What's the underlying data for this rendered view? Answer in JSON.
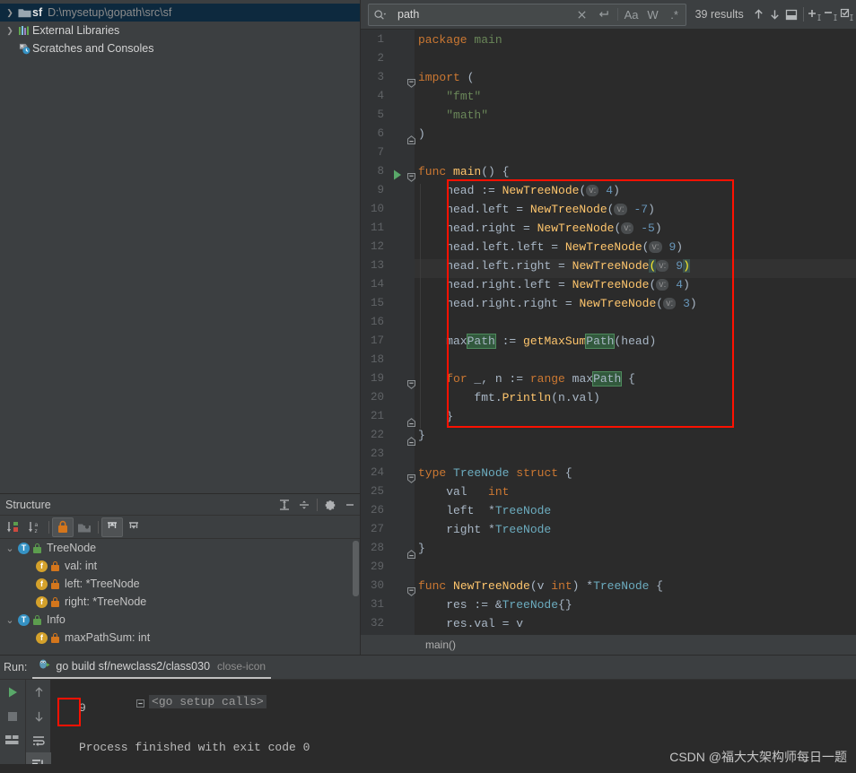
{
  "project": {
    "items": [
      {
        "arrow": "❯",
        "icon": "folder-icon",
        "name": "sf",
        "path": "D:\\mysetup\\gopath\\src\\sf",
        "selected": true
      },
      {
        "arrow": "❯",
        "icon": "libraries-icon",
        "name": "External Libraries",
        "path": "",
        "selected": false
      },
      {
        "arrow": "",
        "icon": "scratches-icon",
        "name": "Scratches and Consoles",
        "path": "",
        "selected": false
      }
    ]
  },
  "search": {
    "magnifier_icon": "search-icon",
    "dropdown_icon": "chevron-down-icon",
    "value": "path",
    "placeholder": "Search",
    "clear_icon": "close-icon",
    "newline_icon": "newline-icon",
    "match_case_label": "Aa",
    "words_label": "W",
    "regex_label": ".*",
    "results": "39 results",
    "prev_icon": "arrow-up-icon",
    "next_icon": "arrow-down-icon",
    "open_in_window_icon": "open-in-find-window-icon",
    "add_selection_icon": "add-selection-icon",
    "remove_selection_icon": "remove-selection-icon",
    "select_all_icon": "select-all-occurrences-icon"
  },
  "editor": {
    "caret_line": 13,
    "breadcrumb": "main()",
    "highlight_color": "#32593d",
    "redbox_color": "#ff1100",
    "lines": [
      {
        "n": 1,
        "fold": "",
        "html": "<span class=\"kw\">package</span> <span class=\"pkg\">main</span>"
      },
      {
        "n": 2,
        "fold": "",
        "html": ""
      },
      {
        "n": 3,
        "fold": "open",
        "html": "<span class=\"kw\">import</span> <span class=\"typ\">(</span>"
      },
      {
        "n": 4,
        "fold": "",
        "html": "    <span class=\"str\">\"fmt\"</span>"
      },
      {
        "n": 5,
        "fold": "",
        "html": "    <span class=\"str\">\"math\"</span>"
      },
      {
        "n": 6,
        "fold": "close",
        "html": "<span class=\"typ\">)</span>"
      },
      {
        "n": 7,
        "fold": "",
        "html": ""
      },
      {
        "n": 8,
        "fold": "open",
        "html": "<span class=\"kw\">func</span> <span class=\"fn\">main</span>() {",
        "runmark": true
      },
      {
        "n": 9,
        "fold": "",
        "html": "    head := <span class=\"fn\">NewTreeNode</span>(<span class=\"hint\">v:</span> <span class=\"num\">4</span>)"
      },
      {
        "n": 10,
        "fold": "",
        "html": "    head.left = <span class=\"fn\">NewTreeNode</span>(<span class=\"hint\">v:</span> <span class=\"num\">-7</span>)"
      },
      {
        "n": 11,
        "fold": "",
        "html": "    head.right = <span class=\"fn\">NewTreeNode</span>(<span class=\"hint\">v:</span> <span class=\"num\">-5</span>)"
      },
      {
        "n": 12,
        "fold": "",
        "html": "    head.left.left = <span class=\"fn\">NewTreeNode</span>(<span class=\"hint\">v:</span> <span class=\"num\">9</span>)"
      },
      {
        "n": 13,
        "fold": "",
        "html": "    head.left.right = <span class=\"fn\">NewTreeNode</span><span class=\"brmatch\">(</span><span class=\"hint\">v:</span> <span class=\"num\">9</span><span class=\"brmatch\">)</span>"
      },
      {
        "n": 14,
        "fold": "",
        "html": "    head.right.left = <span class=\"fn\">NewTreeNode</span>(<span class=\"hint\">v:</span> <span class=\"num\">4</span>)"
      },
      {
        "n": 15,
        "fold": "",
        "html": "    head.right.right = <span class=\"fn\">NewTreeNode</span>(<span class=\"hint\">v:</span> <span class=\"num\">3</span>)"
      },
      {
        "n": 16,
        "fold": "",
        "html": ""
      },
      {
        "n": 17,
        "fold": "",
        "html": "    max<span class=\"match\">Path</span> := <span class=\"fn\">getMaxSum</span><span class=\"match\">Path</span>(head)"
      },
      {
        "n": 18,
        "fold": "",
        "html": ""
      },
      {
        "n": 19,
        "fold": "open",
        "html": "    <span class=\"kw\">for</span> _, n := <span class=\"kw\">range</span> max<span class=\"match\">Path</span> {"
      },
      {
        "n": 20,
        "fold": "",
        "html": "        fmt.<span class=\"fn\">Println</span>(n.val)"
      },
      {
        "n": 21,
        "fold": "close",
        "html": "    }"
      },
      {
        "n": 22,
        "fold": "close",
        "html": "}"
      },
      {
        "n": 23,
        "fold": "",
        "html": ""
      },
      {
        "n": 24,
        "fold": "open",
        "html": "<span class=\"kw\">type</span> <span class=\"cls\">TreeNode</span> <span class=\"kw\">struct</span> {"
      },
      {
        "n": 25,
        "fold": "",
        "html": "    val   <span class=\"kw\">int</span>"
      },
      {
        "n": 26,
        "fold": "",
        "html": "    left  *<span class=\"cls\">TreeNode</span>"
      },
      {
        "n": 27,
        "fold": "",
        "html": "    right *<span class=\"cls\">TreeNode</span>"
      },
      {
        "n": 28,
        "fold": "close",
        "html": "}"
      },
      {
        "n": 29,
        "fold": "",
        "html": ""
      },
      {
        "n": 30,
        "fold": "open",
        "html": "<span class=\"kw\">func</span> <span class=\"fn\">NewTreeNode</span>(v <span class=\"kw\">int</span>) *<span class=\"cls\">TreeNode</span> {"
      },
      {
        "n": 31,
        "fold": "",
        "html": "    res := &amp;<span class=\"cls\">TreeNode</span>{}"
      },
      {
        "n": 32,
        "fold": "",
        "html": "    res.val = v"
      }
    ]
  },
  "structure": {
    "title": "Structure",
    "header_buttons": [
      {
        "icon": "expand-all-icon"
      },
      {
        "icon": "collapse-all-icon"
      },
      {
        "icon": "gear-icon"
      },
      {
        "icon": "minimize-icon"
      }
    ],
    "toolbar": [
      {
        "icon": "sort-by-visibility-icon",
        "active": false
      },
      {
        "icon": "sort-alphabetically-icon",
        "active": false
      },
      {
        "icon": "show-non-public-icon",
        "active": true
      },
      {
        "icon": "show-fields-icon",
        "active": false
      },
      {
        "icon": "expand-all-icon",
        "active": true
      },
      {
        "icon": "collapse-all-icon",
        "active": false
      }
    ],
    "items": [
      {
        "arrow": "⌄",
        "kind": "T",
        "lock": "green",
        "label": "TreeNode",
        "indent": 0,
        "selected": false
      },
      {
        "arrow": "",
        "kind": "f",
        "lock": "orange",
        "label": "val: int",
        "indent": 1,
        "selected": false
      },
      {
        "arrow": "",
        "kind": "f",
        "lock": "orange",
        "label": "left: *TreeNode",
        "indent": 1,
        "selected": false
      },
      {
        "arrow": "",
        "kind": "f",
        "lock": "orange",
        "label": "right: *TreeNode",
        "indent": 1,
        "selected": false
      },
      {
        "arrow": "⌄",
        "kind": "T",
        "lock": "green",
        "label": "Info",
        "indent": 0,
        "selected": false
      },
      {
        "arrow": "",
        "kind": "f",
        "lock": "orange",
        "label": "maxPathSum: int",
        "indent": 1,
        "selected": false
      }
    ]
  },
  "run": {
    "label": "Run:",
    "tab_icon": "go-run-icon",
    "tab_label": "go build sf/newclass2/class030",
    "tab_close_icon": "close-icon",
    "left_toolbar": [
      {
        "icon": "rerun-icon",
        "active": false
      },
      {
        "icon": "stop-icon",
        "active": false
      },
      {
        "icon": "layout-icon",
        "active": false
      }
    ],
    "left_toolbar2": [
      {
        "icon": "arrow-up-icon",
        "active": false
      },
      {
        "icon": "arrow-down-icon",
        "active": false
      },
      {
        "icon": "soft-wrap-icon",
        "active": false
      },
      {
        "icon": "scroll-to-end-icon",
        "active": true
      }
    ],
    "console": {
      "fold_label": "<go setup calls>",
      "output": "9",
      "exit_message": "Process finished with exit code 0",
      "highlight_color": "#ff1100"
    }
  },
  "watermark": "CSDN @福大大架构师每日一题"
}
